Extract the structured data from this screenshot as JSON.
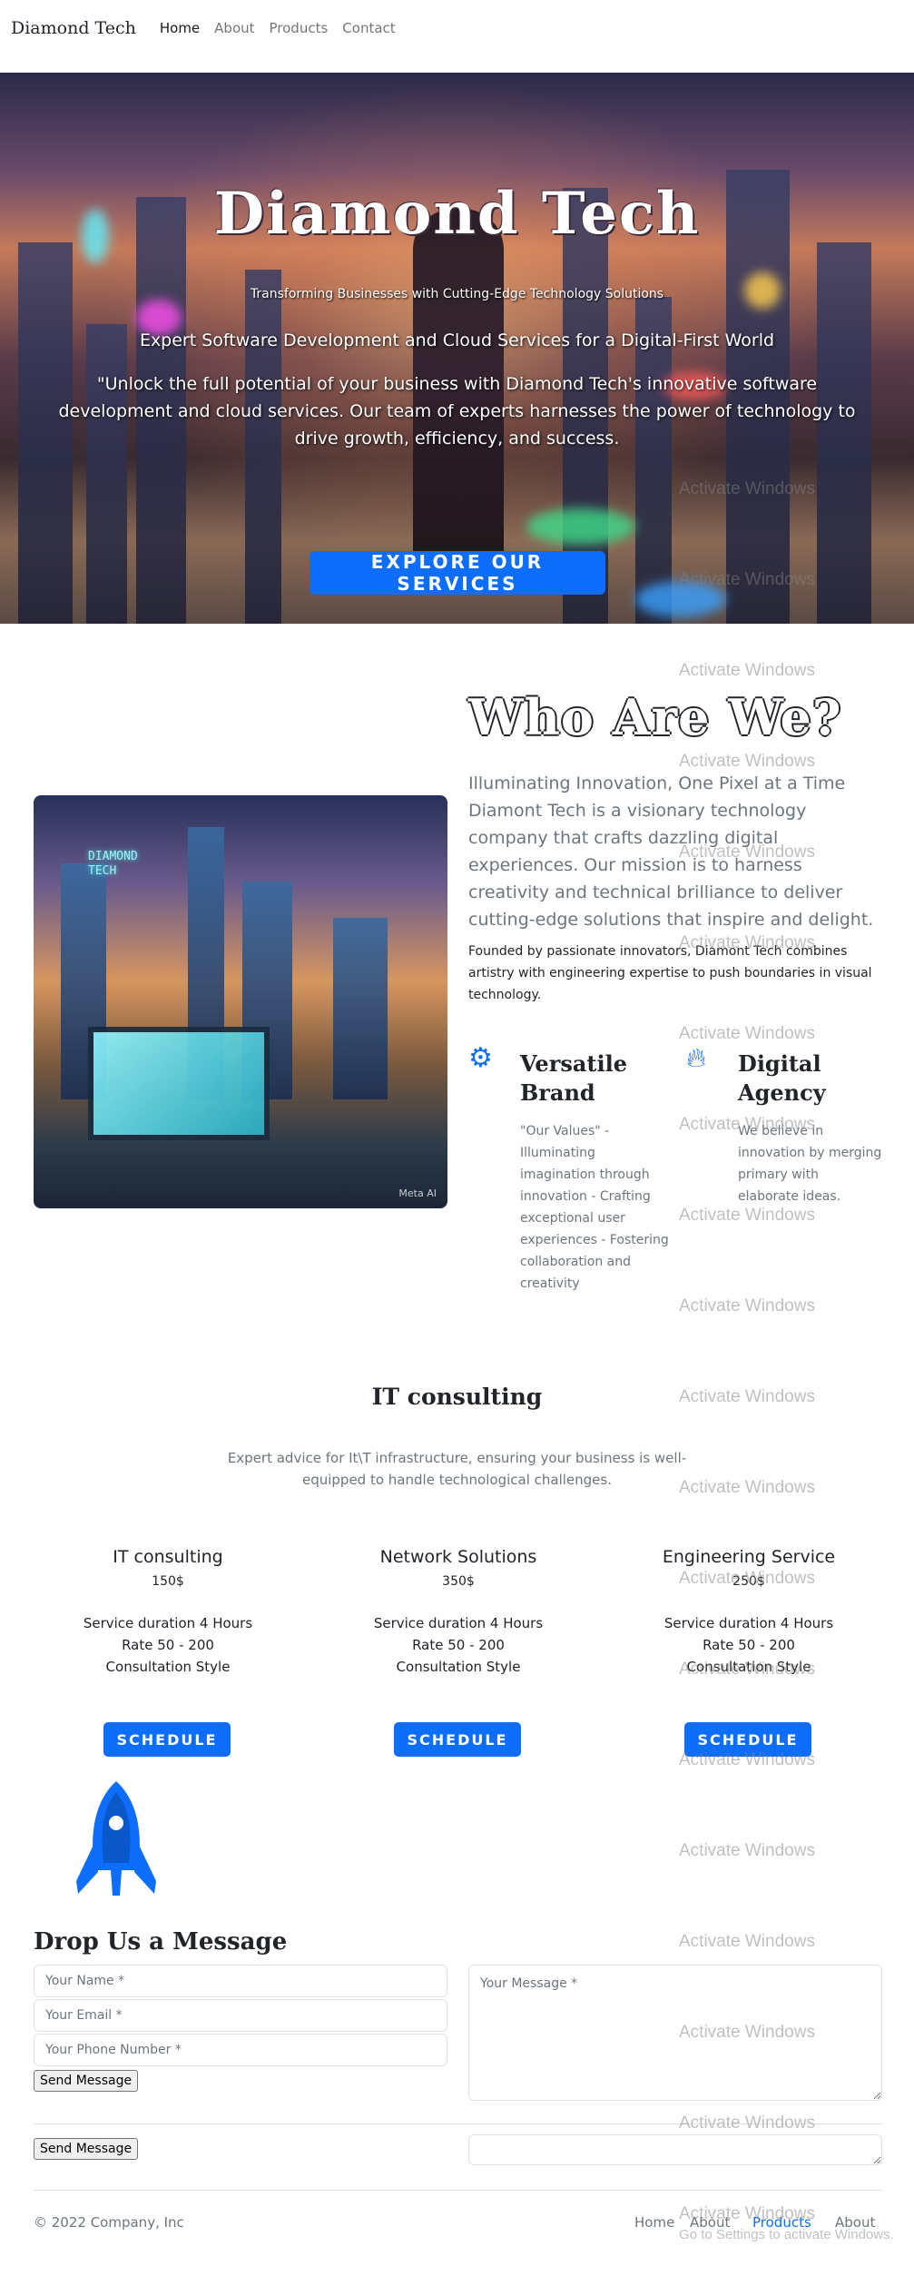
{
  "navbar": {
    "brand": "Diamond Tech",
    "links": [
      "Home",
      "About",
      "Products",
      "Contact"
    ]
  },
  "hero": {
    "title": "Diamond Tech",
    "subtitle": "Transforming Businesses with Cutting-Edge Technology Solutions",
    "lead": "Expert Software Development and Cloud Services for a Digital-First World",
    "text": "\"Unlock the full potential of your business with Diamond Tech's innovative software development and cloud services. Our team of experts harnesses the power of technology to drive growth, efficiency, and success.",
    "button": "EXPLORE OUR SERVICES"
  },
  "about": {
    "image_caption": "Meta AI",
    "image_sign": "DIAMOND\nTECH",
    "title": "Who Are We?",
    "lead": "Illuminating Innovation, One Pixel at a Time Diamont Tech is a visionary technology company that crafts dazzling digital experiences. Our mission is to harness creativity and technical brilliance to deliver cutting-edge solutions that inspire and delight.",
    "small": "Founded by passionate innovators, Diamont Tech combines artistry with engineering expertise to push boundaries in visual technology.",
    "features": [
      {
        "icon": "gear-icon",
        "title": "Versatile Brand",
        "text": "\"Our Values\" - Illuminating imagination through innovation - Crafting exceptional user experiences - Fostering collaboration and creativity"
      },
      {
        "icon": "fire-icon",
        "title": "Digital Agency",
        "text": "We believe in innovation by merging primary with elaborate ideas."
      }
    ]
  },
  "pricing": {
    "title": "IT consulting",
    "description": "Expert advice for It\\T infrastructure, ensuring your business is well-equipped to handle technological challenges.",
    "cards": [
      {
        "name": "IT consulting",
        "price": "150$",
        "items": [
          "Service duration 4 Hours",
          "Rate 50 - 200",
          "Consultation Style"
        ],
        "button": "SCHEDULE"
      },
      {
        "name": "Network Solutions",
        "price": "350$",
        "items": [
          "Service duration 4 Hours",
          "Rate 50 - 200",
          "Consultation Style"
        ],
        "button": "SCHEDULE"
      },
      {
        "name": "Engineering Service",
        "price": "250$",
        "items": [
          "Service duration 4 Hours",
          "Rate 50 - 200",
          "Consultation Style"
        ],
        "button": "SCHEDULE"
      }
    ]
  },
  "contact": {
    "title": "Drop Us a Message",
    "name_placeholder": "Your Name *",
    "email_placeholder": "Your Email *",
    "phone_placeholder": "Your Phone Number *",
    "message_placeholder": "Your Message *",
    "send_label": "Send Message"
  },
  "footer": {
    "copyright": "© 2022 Company, Inc",
    "links": [
      "Home",
      "About",
      "Products",
      "About"
    ],
    "active_link": "Products"
  },
  "watermark": {
    "text": "Activate Windows",
    "subtext": "Go to Settings to activate Windows."
  },
  "colors": {
    "accent": "#0d6efd",
    "muted": "#6c757d"
  }
}
